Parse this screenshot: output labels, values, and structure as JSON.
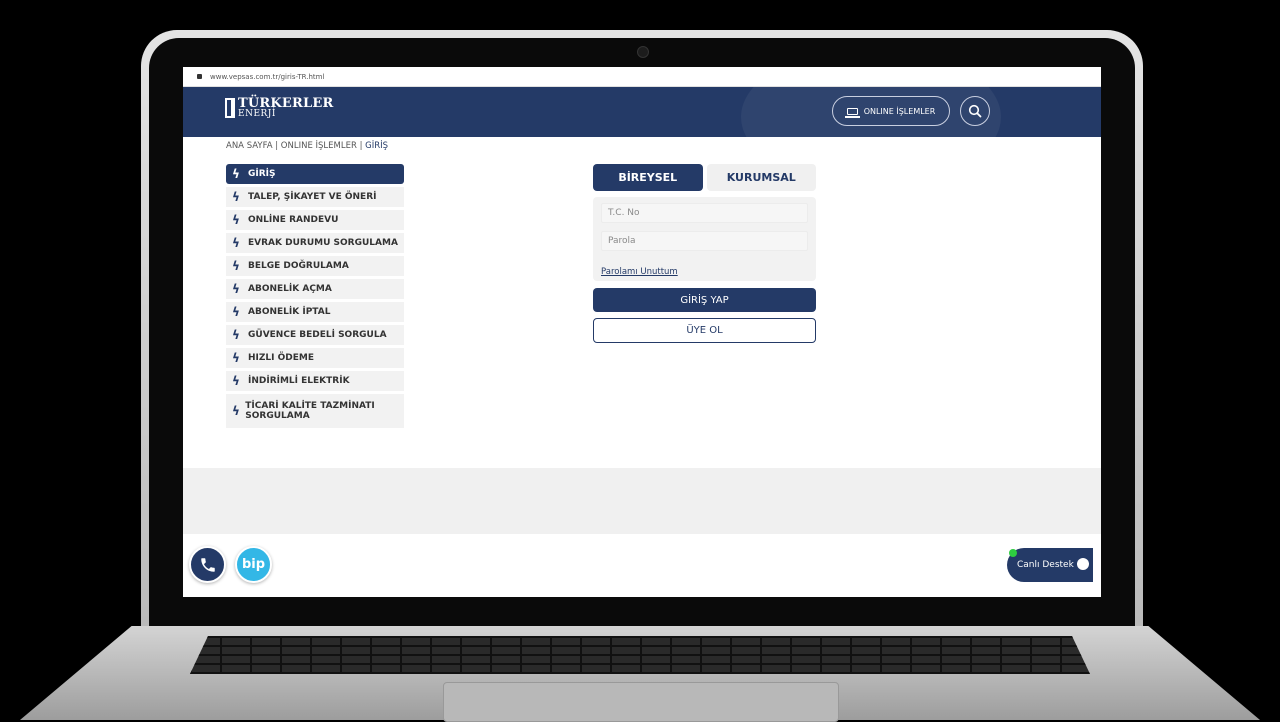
{
  "browser": {
    "url": "www.vepsas.com.tr/giris-TR.html"
  },
  "header": {
    "logo_line1": "TÜRKERLER",
    "logo_line2": "ENERJİ",
    "online_label": "ONLINE İŞLEMLER"
  },
  "breadcrumb": {
    "home": "ANA SAYFA",
    "sep1": " | ",
    "online": "ONLINE İŞLEMLER",
    "sep2": " | ",
    "current": "GİRİŞ"
  },
  "sidebar": {
    "items": [
      {
        "label": "GİRİŞ"
      },
      {
        "label": "TALEP, ŞİKAYET VE ÖNERİ"
      },
      {
        "label": "ONLİNE RANDEVU"
      },
      {
        "label": "EVRAK DURUMU SORGULAMA"
      },
      {
        "label": "BELGE DOĞRULAMA"
      },
      {
        "label": "ABONELİK AÇMA"
      },
      {
        "label": "ABONELİK İPTAL"
      },
      {
        "label": "GÜVENCE BEDELİ SORGULA"
      },
      {
        "label": "HIZLI ÖDEME"
      },
      {
        "label": "İNDİRİMLİ ELEKTRİK"
      },
      {
        "label": "TİCARİ KALİTE TAZMİNATI SORGULAMA"
      }
    ]
  },
  "login": {
    "tab_individual": "BİREYSEL",
    "tab_corporate": "KURUMSAL",
    "tc_placeholder": "T.C. No",
    "password_placeholder": "Parola",
    "forgot_link": "Parolamı Unuttum",
    "login_button": "GİRİŞ YAP",
    "signup_button": "ÜYE OL"
  },
  "footer": {
    "bip_label": "bip",
    "live_support": "Canlı Destek"
  },
  "colors": {
    "brand": "#243a67",
    "bip": "#33b7e6",
    "online": "#2ecc40"
  }
}
